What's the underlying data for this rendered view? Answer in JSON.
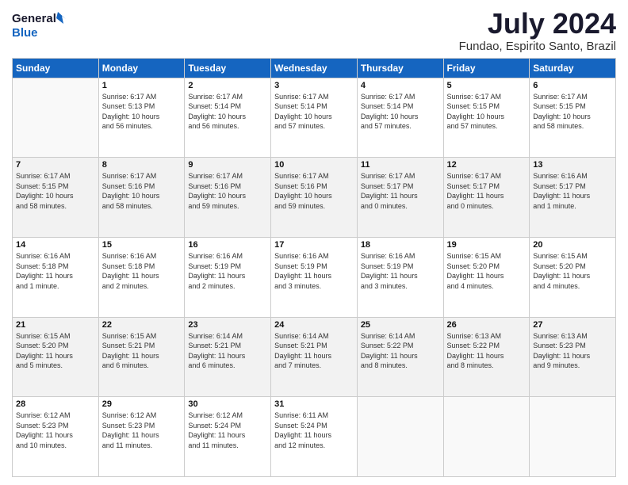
{
  "logo": {
    "line1": "General",
    "line2": "Blue"
  },
  "title": "July 2024",
  "subtitle": "Fundao, Espirito Santo, Brazil",
  "weekdays": [
    "Sunday",
    "Monday",
    "Tuesday",
    "Wednesday",
    "Thursday",
    "Friday",
    "Saturday"
  ],
  "weeks": [
    [
      {
        "day": "",
        "info": ""
      },
      {
        "day": "1",
        "info": "Sunrise: 6:17 AM\nSunset: 5:13 PM\nDaylight: 10 hours\nand 56 minutes."
      },
      {
        "day": "2",
        "info": "Sunrise: 6:17 AM\nSunset: 5:14 PM\nDaylight: 10 hours\nand 56 minutes."
      },
      {
        "day": "3",
        "info": "Sunrise: 6:17 AM\nSunset: 5:14 PM\nDaylight: 10 hours\nand 57 minutes."
      },
      {
        "day": "4",
        "info": "Sunrise: 6:17 AM\nSunset: 5:14 PM\nDaylight: 10 hours\nand 57 minutes."
      },
      {
        "day": "5",
        "info": "Sunrise: 6:17 AM\nSunset: 5:15 PM\nDaylight: 10 hours\nand 57 minutes."
      },
      {
        "day": "6",
        "info": "Sunrise: 6:17 AM\nSunset: 5:15 PM\nDaylight: 10 hours\nand 58 minutes."
      }
    ],
    [
      {
        "day": "7",
        "info": "Sunrise: 6:17 AM\nSunset: 5:15 PM\nDaylight: 10 hours\nand 58 minutes."
      },
      {
        "day": "8",
        "info": "Sunrise: 6:17 AM\nSunset: 5:16 PM\nDaylight: 10 hours\nand 58 minutes."
      },
      {
        "day": "9",
        "info": "Sunrise: 6:17 AM\nSunset: 5:16 PM\nDaylight: 10 hours\nand 59 minutes."
      },
      {
        "day": "10",
        "info": "Sunrise: 6:17 AM\nSunset: 5:16 PM\nDaylight: 10 hours\nand 59 minutes."
      },
      {
        "day": "11",
        "info": "Sunrise: 6:17 AM\nSunset: 5:17 PM\nDaylight: 11 hours\nand 0 minutes."
      },
      {
        "day": "12",
        "info": "Sunrise: 6:17 AM\nSunset: 5:17 PM\nDaylight: 11 hours\nand 0 minutes."
      },
      {
        "day": "13",
        "info": "Sunrise: 6:16 AM\nSunset: 5:17 PM\nDaylight: 11 hours\nand 1 minute."
      }
    ],
    [
      {
        "day": "14",
        "info": "Sunrise: 6:16 AM\nSunset: 5:18 PM\nDaylight: 11 hours\nand 1 minute."
      },
      {
        "day": "15",
        "info": "Sunrise: 6:16 AM\nSunset: 5:18 PM\nDaylight: 11 hours\nand 2 minutes."
      },
      {
        "day": "16",
        "info": "Sunrise: 6:16 AM\nSunset: 5:19 PM\nDaylight: 11 hours\nand 2 minutes."
      },
      {
        "day": "17",
        "info": "Sunrise: 6:16 AM\nSunset: 5:19 PM\nDaylight: 11 hours\nand 3 minutes."
      },
      {
        "day": "18",
        "info": "Sunrise: 6:16 AM\nSunset: 5:19 PM\nDaylight: 11 hours\nand 3 minutes."
      },
      {
        "day": "19",
        "info": "Sunrise: 6:15 AM\nSunset: 5:20 PM\nDaylight: 11 hours\nand 4 minutes."
      },
      {
        "day": "20",
        "info": "Sunrise: 6:15 AM\nSunset: 5:20 PM\nDaylight: 11 hours\nand 4 minutes."
      }
    ],
    [
      {
        "day": "21",
        "info": "Sunrise: 6:15 AM\nSunset: 5:20 PM\nDaylight: 11 hours\nand 5 minutes."
      },
      {
        "day": "22",
        "info": "Sunrise: 6:15 AM\nSunset: 5:21 PM\nDaylight: 11 hours\nand 6 minutes."
      },
      {
        "day": "23",
        "info": "Sunrise: 6:14 AM\nSunset: 5:21 PM\nDaylight: 11 hours\nand 6 minutes."
      },
      {
        "day": "24",
        "info": "Sunrise: 6:14 AM\nSunset: 5:21 PM\nDaylight: 11 hours\nand 7 minutes."
      },
      {
        "day": "25",
        "info": "Sunrise: 6:14 AM\nSunset: 5:22 PM\nDaylight: 11 hours\nand 8 minutes."
      },
      {
        "day": "26",
        "info": "Sunrise: 6:13 AM\nSunset: 5:22 PM\nDaylight: 11 hours\nand 8 minutes."
      },
      {
        "day": "27",
        "info": "Sunrise: 6:13 AM\nSunset: 5:23 PM\nDaylight: 11 hours\nand 9 minutes."
      }
    ],
    [
      {
        "day": "28",
        "info": "Sunrise: 6:12 AM\nSunset: 5:23 PM\nDaylight: 11 hours\nand 10 minutes."
      },
      {
        "day": "29",
        "info": "Sunrise: 6:12 AM\nSunset: 5:23 PM\nDaylight: 11 hours\nand 11 minutes."
      },
      {
        "day": "30",
        "info": "Sunrise: 6:12 AM\nSunset: 5:24 PM\nDaylight: 11 hours\nand 11 minutes."
      },
      {
        "day": "31",
        "info": "Sunrise: 6:11 AM\nSunset: 5:24 PM\nDaylight: 11 hours\nand 12 minutes."
      },
      {
        "day": "",
        "info": ""
      },
      {
        "day": "",
        "info": ""
      },
      {
        "day": "",
        "info": ""
      }
    ]
  ]
}
